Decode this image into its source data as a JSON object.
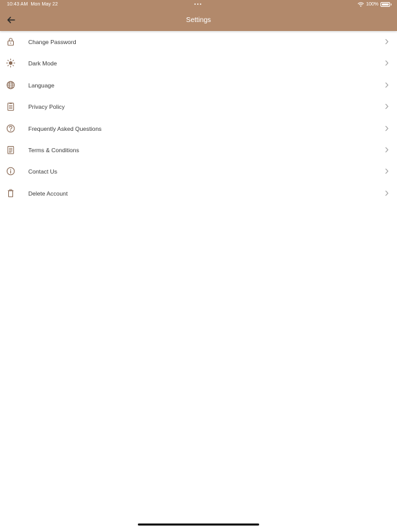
{
  "status_bar": {
    "time": "10:43 AM",
    "date": "Mon May 22",
    "battery_text": "100%",
    "battery_level": 1.0,
    "wifi_icon": "wifi-icon",
    "battery_icon": "battery-icon"
  },
  "header": {
    "title": "Settings",
    "back_icon": "arrow-left-icon",
    "background_color": "#b2896b"
  },
  "colors": {
    "accent": "#b2896b",
    "icon": "#8a6a55",
    "chevron": "#9a9a9a"
  },
  "settings_items": [
    {
      "label": "Change Password",
      "icon": "lock-icon"
    },
    {
      "label": "Dark Mode",
      "icon": "sun-icon"
    },
    {
      "label": "Language",
      "icon": "globe-icon"
    },
    {
      "label": "Privacy Policy",
      "icon": "clipboard-icon"
    },
    {
      "label": "Frequently Asked Questions",
      "icon": "question-circle-icon"
    },
    {
      "label": "Terms & Conditions",
      "icon": "document-icon"
    },
    {
      "label": "Contact Us",
      "icon": "info-circle-icon"
    },
    {
      "label": "Delete Account",
      "icon": "trash-icon"
    }
  ]
}
